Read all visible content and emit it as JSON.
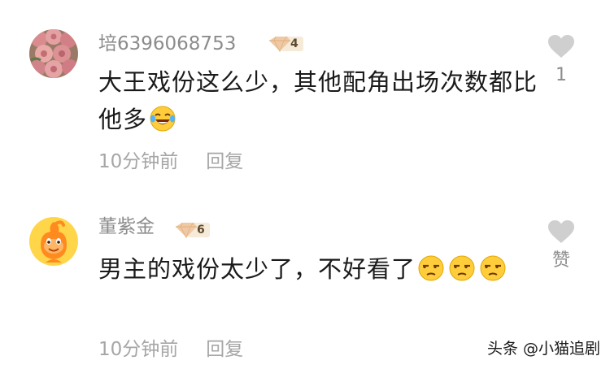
{
  "comments": [
    {
      "username": "培6396068753",
      "level": "4",
      "text": "大王戏份这么少，其他配角出场次数都比他多",
      "time": "10分钟前",
      "reply_label": "回复",
      "like_count": "1",
      "avatar_icon": "rose-bouquet-avatar",
      "emojis": [
        "laughing-tears-emoji"
      ]
    },
    {
      "username": "董紫金",
      "level": "6",
      "text": "男主的戏份太少了，不好看了",
      "time": "10分钟前",
      "reply_label": "回复",
      "like_count": "赞",
      "avatar_icon": "orange-mascot-avatar",
      "emojis": [
        "unamused-face-emoji",
        "unamused-face-emoji",
        "unamused-face-emoji"
      ]
    }
  ],
  "watermark": "头条 @小猫追剧",
  "colors": {
    "username": "#8c8c8c",
    "body_text": "#1a1a1a",
    "meta": "#a6a6a6",
    "heart": "#cfcfcf",
    "badge": "#f0c9a4"
  }
}
